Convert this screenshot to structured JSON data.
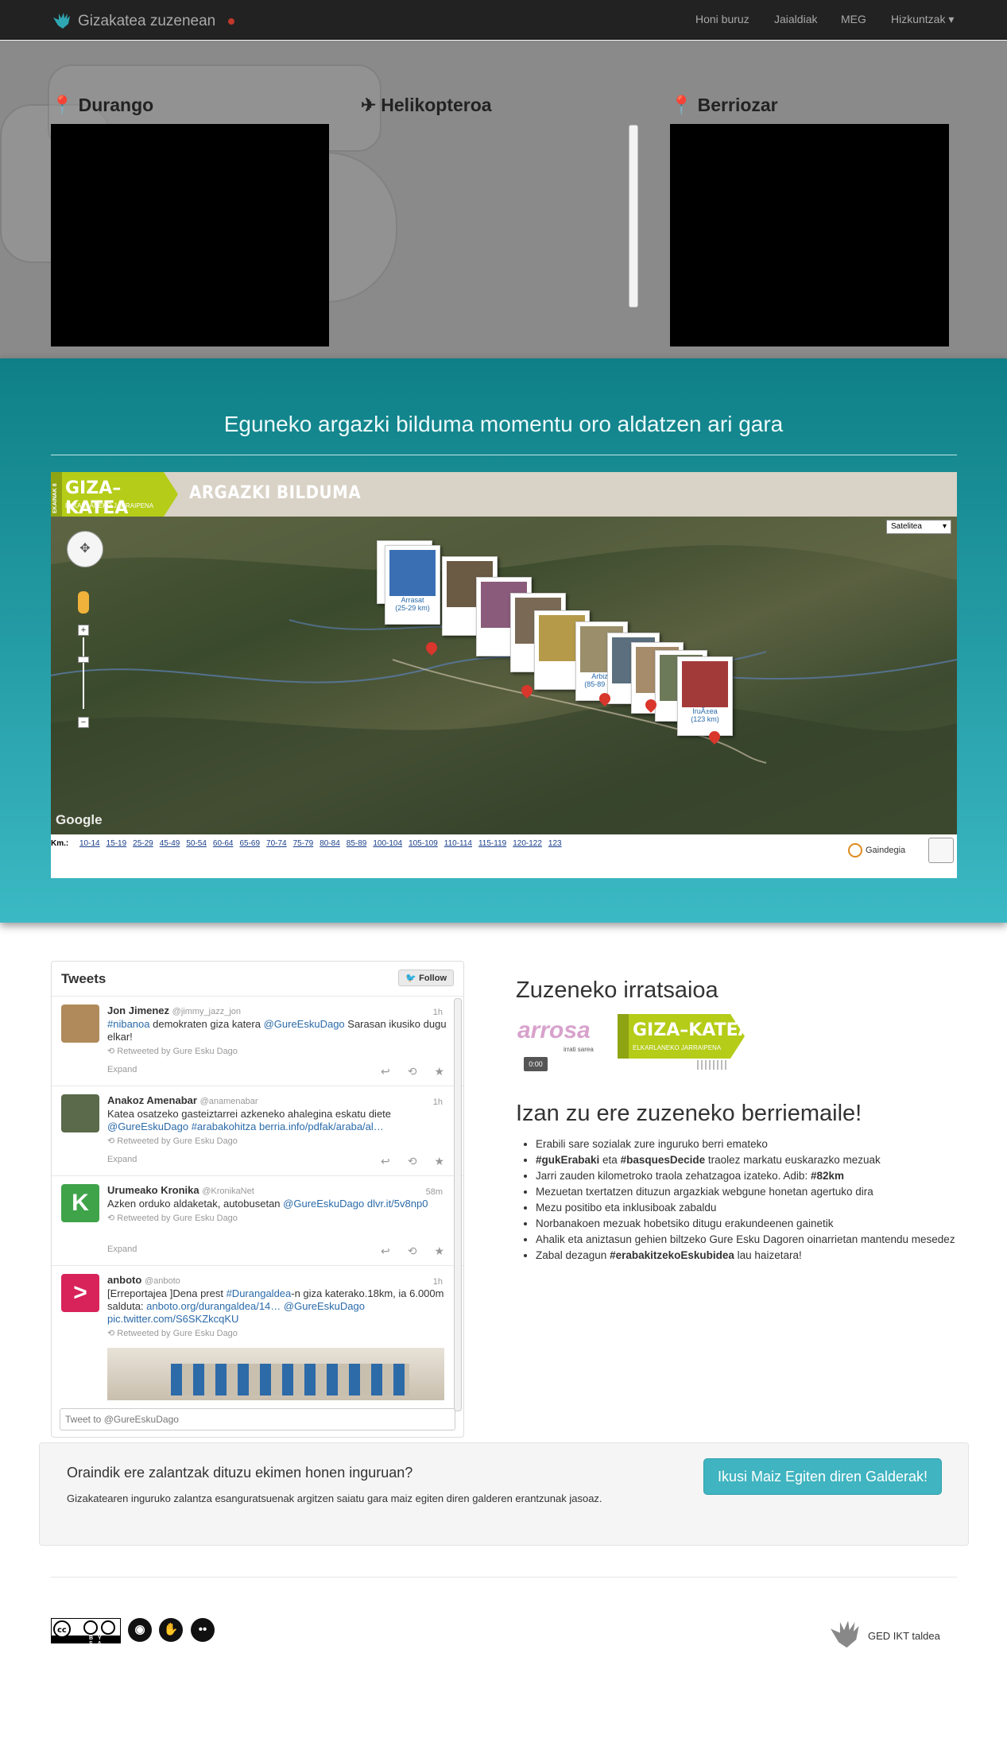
{
  "nav": {
    "brand": "Gizakatea zuzenean",
    "links": [
      "Honi buruz",
      "Jaialdiak",
      "MEG",
      "Hizkuntzak"
    ]
  },
  "hero": {
    "videos": [
      {
        "title": "Durango",
        "icon": "map-marker-icon"
      },
      {
        "title": "Helikopteroa",
        "icon": "plane-icon"
      },
      {
        "title": "Berriozar",
        "icon": "map-marker-icon"
      }
    ]
  },
  "band": {
    "title": "Eguneko argazki bilduma momentu oro aldatzen ari gara",
    "map_header": "ARGAZKI BILDUMA",
    "logo_main": "GIZA–KATEA",
    "logo_sub": "ELKARLANEKO JARRAIPENA",
    "logo_side": "EKAINAK 8",
    "map_type": "Satelitea",
    "google": "Google",
    "km_label": "Km.:",
    "km_ranges": [
      "10-14",
      "15-19",
      "25-29",
      "45-49",
      "50-54",
      "60-64",
      "65-69",
      "70-74",
      "75-79",
      "80-84",
      "85-89",
      "100-104",
      "105-109",
      "110-114",
      "115-119",
      "120-122",
      "123"
    ],
    "photo_labels": [
      {
        "name": "Arrasat",
        "km": "(25-29 km)"
      },
      {
        "name": "Arbizu",
        "km": "(85-89 km)"
      },
      {
        "name": "IruÃ±ea",
        "km": "(123 km)"
      }
    ],
    "gaindegia": "Gaindegia"
  },
  "tweets": {
    "heading": "Tweets",
    "follow": "Follow",
    "items": [
      {
        "name": "Jon Jimenez",
        "handle": "@jimmy_jazz_jon",
        "time": "1h",
        "text_a": "#nibanoa",
        "text_b": " demokraten giza katera ",
        "text_c": "@GureEskuDago",
        "text_d": " Sarasan ikusiko dugu elkar!",
        "rt": "Retweeted by Gure Esku Dago",
        "expand": "Expand"
      },
      {
        "name": "Anakoz Amenabar",
        "handle": "@anamenabar",
        "time": "1h",
        "text_a": "Katea osatzeko gasteiztarrei azkeneko ahalegina eskatu diete ",
        "text_b": "@GureEskuDago #arabakohitza berria.info/pdfak/araba/al…",
        "rt": "Retweeted by Gure Esku Dago",
        "expand": "Expand"
      },
      {
        "name": "Urumeako Kronika",
        "handle": "@KronikaNet",
        "time": "58m",
        "text_a": "Azken orduko aldaketak, autobusetan ",
        "text_b": "@GureEskuDago dlvr.it/5v8np0",
        "rt": "Retweeted by Gure Esku Dago",
        "expand": "Expand"
      },
      {
        "name": "anboto",
        "handle": "@anboto",
        "time": "1h",
        "text_a": "[Erreportajea ]Dena prest ",
        "text_b": "#Durangaldea",
        "text_c": "-n giza katerako.18km, ia 6.000m salduta: ",
        "text_d": "anboto.org/durangaldea/14… @GureEskuDago pic.twitter.com/S6SKZkcqKU",
        "rt": "Retweeted by Gure Esku Dago"
      }
    ],
    "input_placeholder": "Tweet to @GureEskuDago"
  },
  "radio": {
    "title": "Zuzeneko irratsaioa",
    "station": "arrosa",
    "station_sub": "irrati sarea",
    "time": "0:00"
  },
  "izan": {
    "title": "Izan zu ere zuzeneko berriemaile!",
    "items": [
      {
        "pre": "Erabili sare sozialak zure inguruko berri emateko",
        "b1": "",
        "mid": "",
        "b2": "",
        "post": ""
      },
      {
        "pre": "",
        "b1": "#gukErabaki",
        "mid": " eta ",
        "b2": "#basquesDecide",
        "post": " traolez markatu euskarazko mezuak"
      },
      {
        "pre": "Jarri zauden kilometroko traola zehatzagoa izateko. Adib: ",
        "b1": "#82km",
        "mid": "",
        "b2": "",
        "post": ""
      },
      {
        "pre": "Mezuetan txertatzen dituzun argazkiak webgune honetan agertuko dira",
        "b1": "",
        "mid": "",
        "b2": "",
        "post": ""
      },
      {
        "pre": "Mezu positibo eta inklusiboak zabaldu",
        "b1": "",
        "mid": "",
        "b2": "",
        "post": ""
      },
      {
        "pre": "Norbanakoen mezuak hobetsiko ditugu erakundeenen gainetik",
        "b1": "",
        "mid": "",
        "b2": "",
        "post": ""
      },
      {
        "pre": "Ahalik eta aniztasun gehien biltzeko Gure Esku Dagoren oinarrietan mantendu mesedez",
        "b1": "",
        "mid": "",
        "b2": "",
        "post": ""
      },
      {
        "pre": "Zabal dezagun ",
        "b1": "#erabakitzekoEskubidea",
        "mid": " lau haizetara!",
        "b2": "",
        "post": ""
      }
    ]
  },
  "faq": {
    "question": "Oraindik ere zalantzak dituzu ekimen honen inguruan?",
    "text": "Gizakatearen inguruko zalantza esanguratsuenak argitzen saiatu gara maiz egiten diren galderen erantzunak jasoaz.",
    "button": "Ikusi Maiz Egiten diren Galderak!"
  },
  "footer": {
    "cc": "BY SA",
    "team": "GED IKT taldea"
  },
  "colors": {
    "teal": "#0e7f86",
    "lime": "#b5cc18",
    "button": "#40b4c0"
  }
}
